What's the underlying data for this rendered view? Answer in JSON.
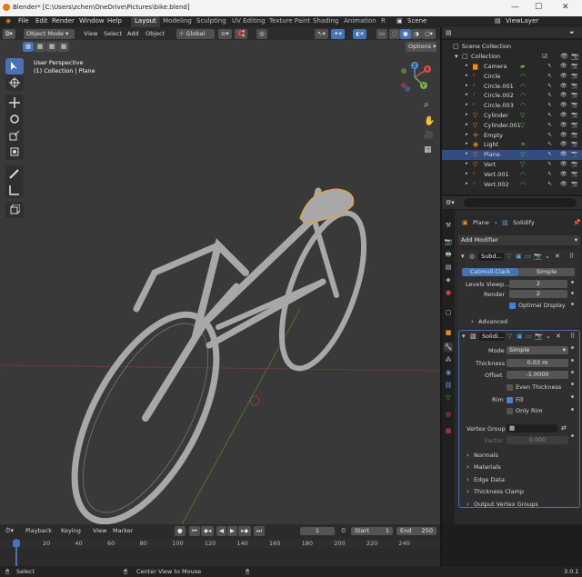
{
  "window": {
    "title": "Blender* [C:\\Users\\zchen\\OneDrive\\Pictures\\bike.blend]",
    "minimize": "—",
    "maximize": "☐",
    "close": "✕"
  },
  "menu": {
    "items": [
      "File",
      "Edit",
      "Render",
      "Window",
      "Help"
    ]
  },
  "workspaces": [
    "Layout",
    "Modeling",
    "Sculpting",
    "UV Editing",
    "Texture Paint",
    "Shading",
    "Animation",
    "R"
  ],
  "scene": {
    "label": "Scene",
    "view_layer": "ViewLayer"
  },
  "viewport_header": {
    "mode": "Object Mode",
    "view": "View",
    "select": "Select",
    "add": "Add",
    "object": "Object",
    "orientation": "Global",
    "options": "Options"
  },
  "viewport_overlay": {
    "line1": "User Perspective",
    "line2": "(1) Collection | Plane"
  },
  "gizmo": {
    "x": "X",
    "y": "Y",
    "z": "Z"
  },
  "outliner": {
    "root": "Scene Collection",
    "collection": "Collection",
    "items": [
      {
        "name": "Camera",
        "icon": "camera-icon"
      },
      {
        "name": "Circle",
        "icon": "curve-icon"
      },
      {
        "name": "Circle.001",
        "icon": "curve-icon"
      },
      {
        "name": "Circle.002",
        "icon": "curve-icon"
      },
      {
        "name": "Circle.003",
        "icon": "curve-icon"
      },
      {
        "name": "Cylinder",
        "icon": "mesh-icon"
      },
      {
        "name": "Cylinder.001",
        "icon": "mesh-icon"
      },
      {
        "name": "Empty",
        "icon": "empty-icon"
      },
      {
        "name": "Light",
        "icon": "light-icon"
      },
      {
        "name": "Plane",
        "icon": "mesh-icon",
        "selected": true
      },
      {
        "name": "Vert",
        "icon": "mesh-icon"
      },
      {
        "name": "Vert.001",
        "icon": "curve-icon"
      },
      {
        "name": "Vert.002",
        "icon": "curve-icon"
      }
    ]
  },
  "properties": {
    "breadcrumb_object": "Plane",
    "breadcrumb_modifier": "Solidify",
    "add_modifier": "Add Modifier",
    "subsurf": {
      "name": "Subd...",
      "tab_catmull": "Catmull-Clark",
      "tab_simple": "Simple",
      "levels_viewport_label": "Levels Viewp...",
      "levels_viewport": "2",
      "render_label": "Render",
      "render": "2",
      "optimal_display": "Optimal Display",
      "advanced": "Advanced"
    },
    "solidify": {
      "name": "Solidi...",
      "mode_label": "Mode",
      "mode": "Simple",
      "thickness_label": "Thickness",
      "thickness": "0.03 m",
      "offset_label": "Offset",
      "offset": "-1.0000",
      "even_thickness": "Even Thickness",
      "rim_label": "Rim",
      "fill": "Fill",
      "only_rim": "Only Rim",
      "vertex_group_label": "Vertex Group",
      "factor_label": "Factor",
      "factor": "0.000",
      "sections": [
        "Normals",
        "Materials",
        "Edge Data",
        "Thickness Clamp",
        "Output Vertex Groups"
      ]
    }
  },
  "timeline": {
    "playback": "Playback",
    "keying": "Keying",
    "view": "View",
    "marker": "Marker",
    "current_frame": "1",
    "start_label": "Start",
    "start": "1",
    "end_label": "End",
    "end": "250",
    "ticks": [
      "1",
      "20",
      "40",
      "60",
      "80",
      "100",
      "120",
      "140",
      "160",
      "180",
      "200",
      "220",
      "240"
    ]
  },
  "status": {
    "select": "Select",
    "center": "Center View to Mouse",
    "version": "3.0.1"
  },
  "colors": {
    "accent": "#4772b3",
    "selection": "#334d80",
    "mesh": "#60b04a",
    "modifier": "#5a9de0"
  }
}
